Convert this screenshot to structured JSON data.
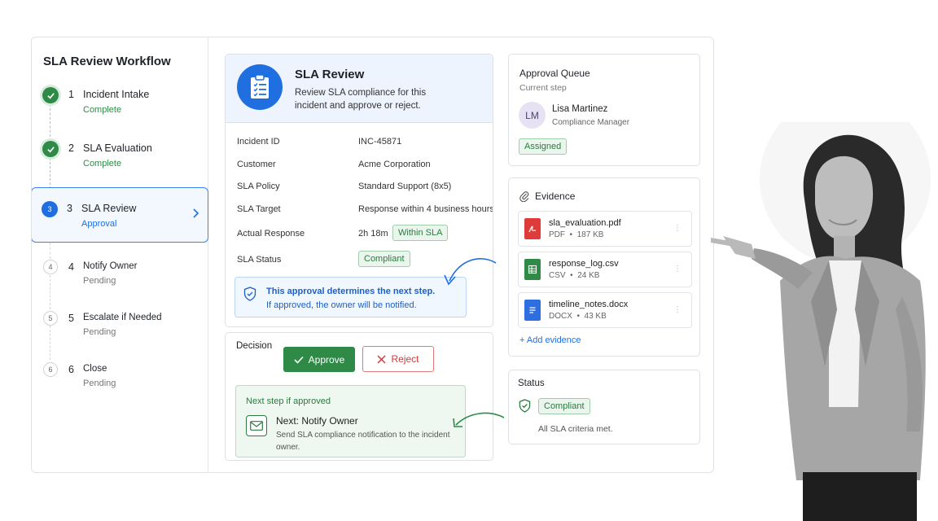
{
  "sidebar": {
    "title": "SLA Review Workflow",
    "steps": [
      {
        "num": "1",
        "indicator": "",
        "name": "Incident Intake",
        "status": "Complete"
      },
      {
        "num": "2",
        "indicator": "",
        "name": "SLA Evaluation",
        "status": "Complete"
      },
      {
        "num": "3",
        "indicator": "3",
        "name": "SLA Review",
        "status": "Approval"
      },
      {
        "num": "4",
        "indicator": "4",
        "name": "Notify Owner",
        "status": "Pending"
      },
      {
        "num": "5",
        "indicator": "5",
        "name": "Escalate if Needed",
        "status": "Pending"
      },
      {
        "num": "6",
        "indicator": "6",
        "name": "Close",
        "status": "Pending"
      }
    ]
  },
  "review": {
    "title": "SLA Review",
    "description": "Review SLA compliance for this incident and approve or reject.",
    "fields": [
      {
        "label": "Incident ID",
        "value": "INC-45871"
      },
      {
        "label": "Customer",
        "value": "Acme Corporation"
      },
      {
        "label": "SLA Policy",
        "value": "Standard Support (8x5)"
      },
      {
        "label": "SLA Target",
        "value": "Response within 4 business hours"
      },
      {
        "label": "Actual Response",
        "value": "2h 18m",
        "badge": "Within SLA"
      },
      {
        "label": "SLA Status",
        "badge": "Compliant"
      }
    ],
    "note_title": "This approval determines the next step.",
    "note_text": "If approved, the owner will be notified."
  },
  "decision": {
    "label": "Decision",
    "approve": "Approve",
    "reject": "Reject",
    "next_header": "Next step if approved",
    "next_title": "Next: Notify Owner",
    "next_desc": "Send SLA compliance notification to the incident owner."
  },
  "queue": {
    "title": "Approval Queue",
    "subtitle": "Current step",
    "initials": "LM",
    "name": "Lisa Martinez",
    "role": "Compliance Manager",
    "badge": "Assigned"
  },
  "evidence": {
    "title": "Evidence",
    "files": [
      {
        "name": "sla_evaluation.pdf",
        "type": "PDF",
        "size": "187 KB",
        "color": "#e03b3b",
        "icon": "pdf-file-icon"
      },
      {
        "name": "response_log.csv",
        "type": "CSV",
        "size": "24 KB",
        "color": "#2f8a47",
        "icon": "spreadsheet-file-icon"
      },
      {
        "name": "timeline_notes.docx",
        "type": "DOCX",
        "size": "43 KB",
        "color": "#2d6fe0",
        "icon": "document-file-icon"
      }
    ],
    "add_label": "+ Add evidence"
  },
  "status": {
    "title": "Status",
    "badge": "Compliant",
    "note": "All SLA criteria met."
  },
  "colors": {
    "accent_blue": "#1f6fe0",
    "success_green": "#2f8a47",
    "danger_red": "#d23a3a"
  }
}
